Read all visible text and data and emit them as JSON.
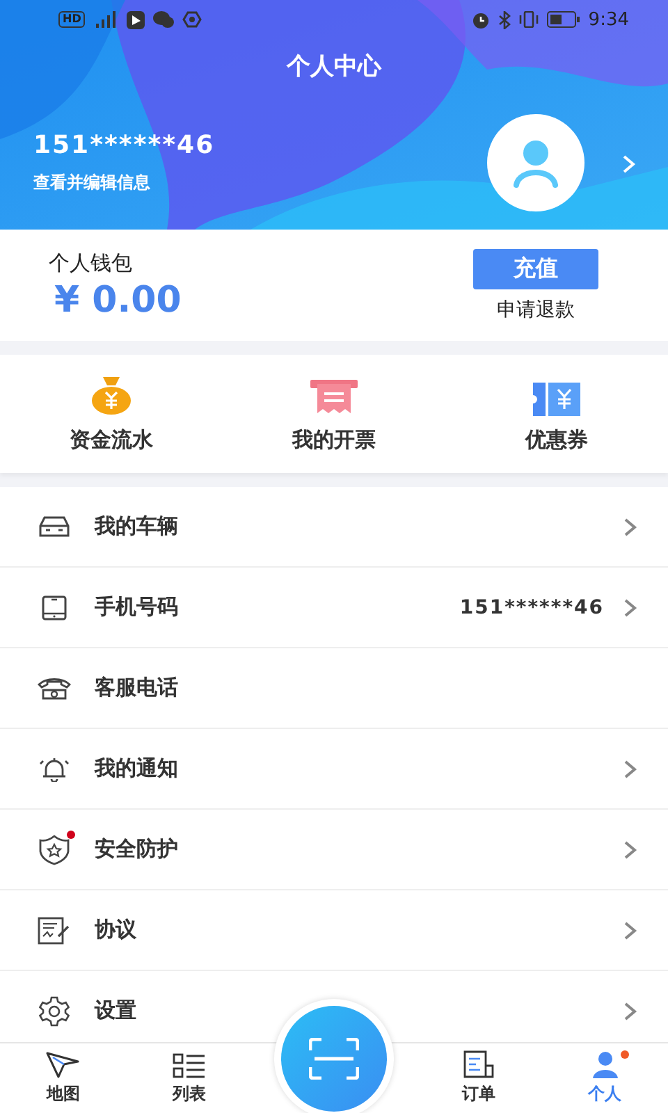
{
  "status_bar": {
    "network_badge": "HD",
    "time": "9:34"
  },
  "header": {
    "title": "个人中心",
    "phone": "151******46",
    "edit_link": "查看并编辑信息"
  },
  "wallet": {
    "label": "个人钱包",
    "amount": "¥ 0.00",
    "recharge_button": "充值",
    "refund_link": "申请退款"
  },
  "shortcuts": [
    {
      "label": "资金流水"
    },
    {
      "label": "我的开票"
    },
    {
      "label": "优惠券"
    }
  ],
  "menu": [
    {
      "label": "我的车辆",
      "chevron": true,
      "badge": false
    },
    {
      "label": "手机号码",
      "value": "151******46",
      "chevron": true,
      "badge": false
    },
    {
      "label": "客服电话",
      "chevron": false,
      "badge": false
    },
    {
      "label": "我的通知",
      "chevron": true,
      "badge": false
    },
    {
      "label": "安全防护",
      "chevron": true,
      "badge": true
    },
    {
      "label": "协议",
      "chevron": true,
      "badge": false
    },
    {
      "label": "设置",
      "chevron": true,
      "badge": false
    }
  ],
  "bottom_nav": {
    "tabs": [
      {
        "label": "地图",
        "selected": false,
        "badge": false
      },
      {
        "label": "列表",
        "selected": false,
        "badge": false
      },
      {
        "label": "订单",
        "selected": false,
        "badge": false
      },
      {
        "label": "个人",
        "selected": true,
        "badge": true
      }
    ]
  }
}
